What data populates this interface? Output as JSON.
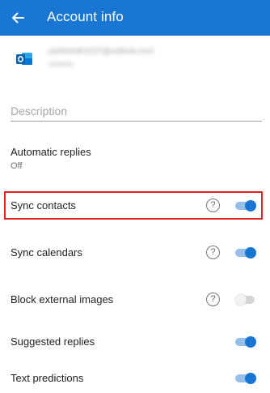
{
  "header": {
    "title": "Account info",
    "back_icon": "arrow-back-icon",
    "color": "#1976d2"
  },
  "account": {
    "logo_icon": "outlook-logo-icon",
    "email": "parthshah1107@outlook.com",
    "provider": "Outlook"
  },
  "description": {
    "placeholder": "Description"
  },
  "automatic_replies": {
    "label": "Automatic replies",
    "status": "Off"
  },
  "settings": [
    {
      "label": "Sync contacts",
      "help": "?",
      "on": true,
      "highlighted": true
    },
    {
      "label": "Sync calendars",
      "help": "?",
      "on": true
    },
    {
      "label": "Block external images",
      "help": "?",
      "on": false
    },
    {
      "label": "Suggested replies",
      "on": true
    },
    {
      "label": "Text predictions",
      "on": true
    }
  ],
  "colors": {
    "accent": "#1976d2",
    "highlight": "#e02020"
  }
}
